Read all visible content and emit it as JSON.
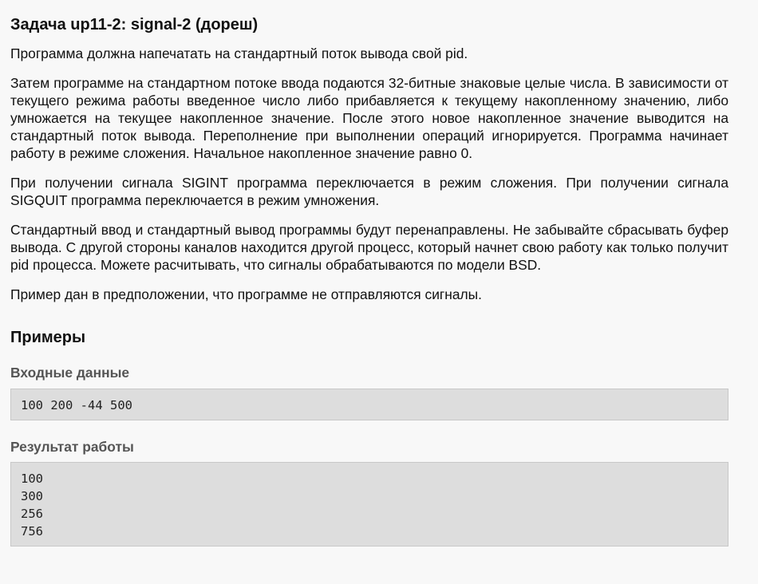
{
  "problem": {
    "title": "Задача up11-2: signal-2 (дореш)",
    "paragraphs": [
      "Программа должна напечатать на стандартный поток вывода свой pid.",
      "Затем программе на стандартном потоке ввода подаются 32-битные знаковые целые числа. В зависимости от текущего режима работы введенное число либо прибавляется к текущему накопленному значению, либо умножается на текущее накопленное значение. После этого новое накопленное значение выводится на стандартный поток вывода. Переполнение при выполнении операций игнорируется. Программа начинает работу в режиме сложения. Начальное накопленное значение равно 0.",
      "При получении сигнала SIGINT программа переключается в режим сложения. При получении сигнала SIGQUIT программа переключается в режим умножения.",
      "Стандартный ввод и стандартный вывод программы будут перенаправлены. Не забывайте сбрасывать буфер вывода. С другой стороны каналов находится другой процесс, который начнет свою работу как только получит pid процесса. Можете расчитывать, что сигналы обрабатываются по модели BSD.",
      "Пример дан в предположении, что программе не отправляются сигналы."
    ]
  },
  "examples": {
    "heading": "Примеры",
    "input_label": "Входные данные",
    "input_value": "100 200 -44 500",
    "output_label": "Результат работы",
    "output_lines": [
      "100",
      "300",
      "256",
      "756"
    ]
  }
}
